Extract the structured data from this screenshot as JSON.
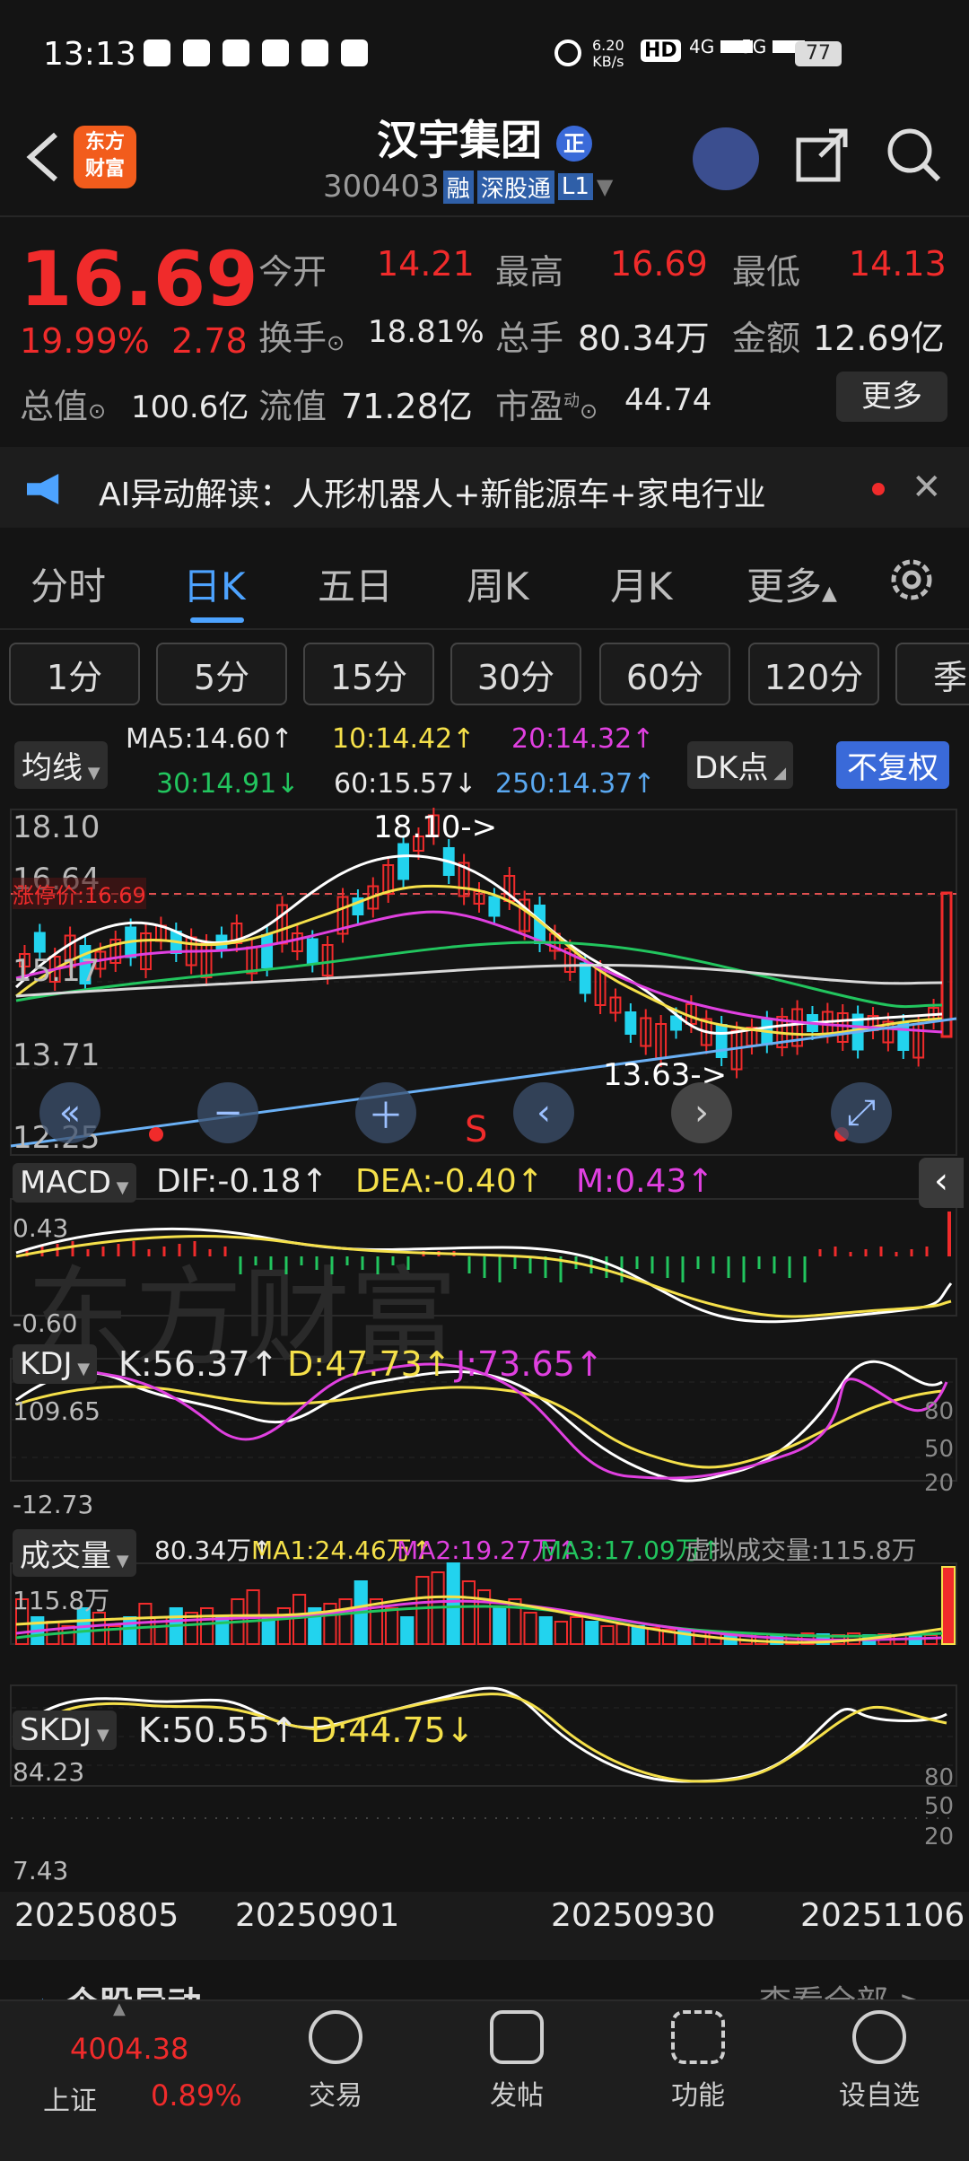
{
  "status_bar": {
    "time": "13:13",
    "net_speed_top": "6.20",
    "net_speed_unit": "KB/s",
    "hd_label": "HD",
    "sig1": "4G",
    "sig2": "5G",
    "battery": "77"
  },
  "header": {
    "logo_line1": "东方",
    "logo_line2": "财富",
    "title": "汉宇集团",
    "title_badge": "正",
    "code": "300403",
    "tag1": "融",
    "tag2": "深股通",
    "tag3": "L1"
  },
  "quote": {
    "price": "16.69",
    "pct": "19.99%",
    "chg": "2.78",
    "open_label": "今开",
    "open": "14.21",
    "high_label": "最高",
    "high": "16.69",
    "low_label": "最低",
    "low": "14.13",
    "turnover_label": "换手",
    "turnover": "18.81%",
    "volume_label": "总手",
    "volume": "80.34万",
    "amount_label": "金额",
    "amount": "12.69亿",
    "mcap_label": "总值",
    "mcap": "100.6亿",
    "float_label": "流值",
    "float": "71.28亿",
    "pe_label": "市盈",
    "pe_sup": "动",
    "pe": "44.74",
    "more": "更多"
  },
  "ai_banner": {
    "text": "AI异动解读：人形机器人+新能源车+家电行业"
  },
  "tabs": [
    "分时",
    "日K",
    "五日",
    "周K",
    "月K",
    "更多"
  ],
  "periods": [
    "1分",
    "5分",
    "15分",
    "30分",
    "60分",
    "120分",
    "季"
  ],
  "ma": {
    "select": "均线",
    "ma5": "MA5:14.60↑",
    "ma10": "10:14.42↑",
    "ma20": "20:14.32↑",
    "ma30": "30:14.91↓",
    "ma60": "60:15.57↓",
    "ma250": "250:14.37↑",
    "dk": "DK点",
    "fuquan": "不复权"
  },
  "kline": {
    "y_top": "18.10",
    "y_mid1": "16.64",
    "y_mid2": "15.17",
    "y_mid3": "13.71",
    "y_bot": "12.25",
    "zt_label": "涨停价:16.69",
    "high_tag": "18.10->",
    "low_tag": "13.63->",
    "s_mark": "S",
    "watermark": "东方财富"
  },
  "macd": {
    "select": "MACD",
    "dif": "DIF:-0.18↑",
    "dea": "DEA:-0.40↑",
    "m": "M:0.43↑",
    "y_top": "0.43",
    "y_bot": "-0.60"
  },
  "kdj": {
    "select": "KDJ",
    "k": "K:56.37↑",
    "d": "D:47.73↑",
    "j": "J:73.65↑",
    "y_top": "109.65",
    "y_bot": "-12.73",
    "r80": "80",
    "r50": "50",
    "r20": "20"
  },
  "vol": {
    "select": "成交量",
    "v": "80.34万↑",
    "ma1": "MA1:24.46万↑",
    "ma2": "MA2:19.27万↑",
    "ma3": "MA3:17.09万↑",
    "virt": "虚拟成交量:115.8万",
    "y_top": "115.8万"
  },
  "skdj": {
    "select": "SKDJ",
    "k": "K:50.55↑",
    "d": "D:44.75↓",
    "y_top": "84.23",
    "y_bot": "7.43",
    "r80": "80",
    "r50": "50",
    "r20": "20"
  },
  "dates": [
    "20250805",
    "20250901",
    "20250930",
    "20251106"
  ],
  "partial_section": {
    "title": "个股异动",
    "more": "查看全部 >"
  },
  "bottom_nav": {
    "index_value": "4004.38",
    "index_name": "上证",
    "index_pct": "0.89%",
    "items": [
      "交易",
      "发帖",
      "功能",
      "设自选"
    ]
  }
}
